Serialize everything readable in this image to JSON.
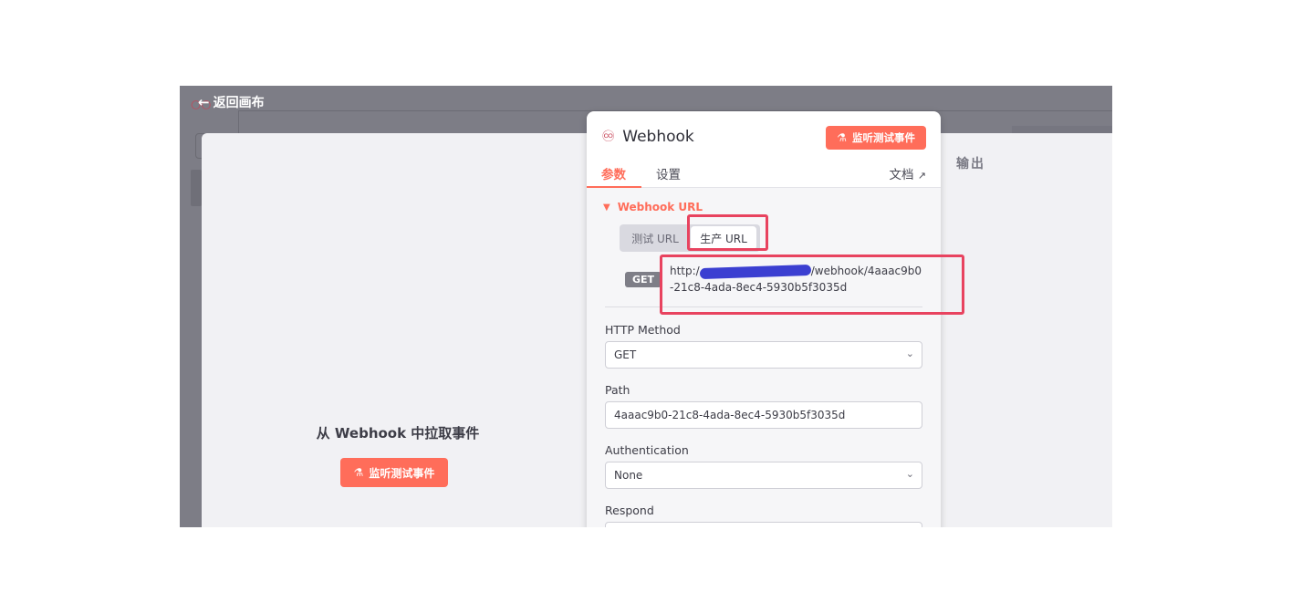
{
  "nav": {
    "back_label": "返回画布",
    "back_icon": "arrow-left-icon"
  },
  "left_pane": {
    "title": "从 Webhook 中拉取事件",
    "button_label": "监听测试事件"
  },
  "output_label": "输出",
  "panel": {
    "title": "Webhook",
    "listen_button": "监听测试事件",
    "tabs": [
      "参数",
      "设置"
    ],
    "docs_label": "文档",
    "webhook_url": {
      "section_label": "Webhook URL",
      "options": [
        "测试 URL",
        "生产 URL"
      ],
      "selected": "生产 URL",
      "method_badge": "GET",
      "url_prefix": "http:/",
      "url_suffix": "/webhook/4aaac9b0-21c8-4ada-8ec4-5930b5f3035d"
    },
    "fields": {
      "http_method": {
        "label": "HTTP Method",
        "value": "GET"
      },
      "path": {
        "label": "Path",
        "value": "4aaac9b0-21c8-4ada-8ec4-5930b5f3035d"
      },
      "authentication": {
        "label": "Authentication",
        "value": "None"
      },
      "respond": {
        "label": "Respond",
        "value": ""
      }
    }
  },
  "colors": {
    "accent": "#ff6d5a",
    "highlight": "#e8435f",
    "overlay": "#7d7d86"
  }
}
